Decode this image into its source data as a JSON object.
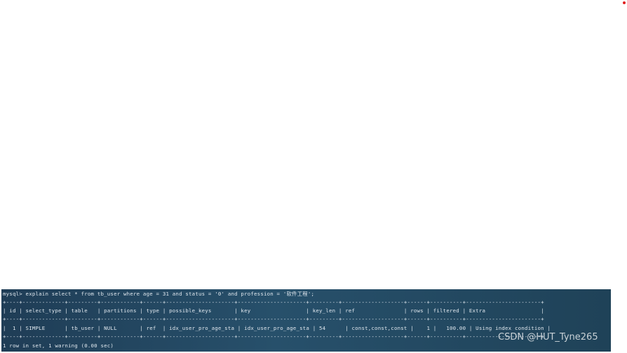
{
  "terminal": {
    "command": "mysql> explain select * from tb_user where age = 31 and status = '0' and profession = '软件工程';",
    "border_top": "+----+-------------+---------+------------+------+---------------------+---------------------+---------+-------------------+------+----------+-----------------------+",
    "header_row": "| id | select_type | table   | partitions | type | possible_keys       | key                 | key_len | ref               | rows | filtered | Extra                 |",
    "border_mid": "+----+-------------+---------+------------+------+---------------------+---------------------+---------+-------------------+------+----------+-----------------------+",
    "data_row": "|  1 | SIMPLE      | tb_user | NULL       | ref  | idx_user_pro_age_sta | idx_user_pro_age_sta | 54      | const,const,const |    1 |   100.00 | Using index condition |",
    "border_bottom": "+----+-------------+---------+------------+------+---------------------+---------------------+---------+-------------------+------+----------+-----------------------+",
    "summary": "1 row in set, 1 warning (0.00 sec)"
  },
  "watermark": "CSDN @HUT_Tyne265",
  "colors": {
    "terminal_bg": "#24475f",
    "terminal_text": "#dfe7ee",
    "dot": "#e02020"
  }
}
